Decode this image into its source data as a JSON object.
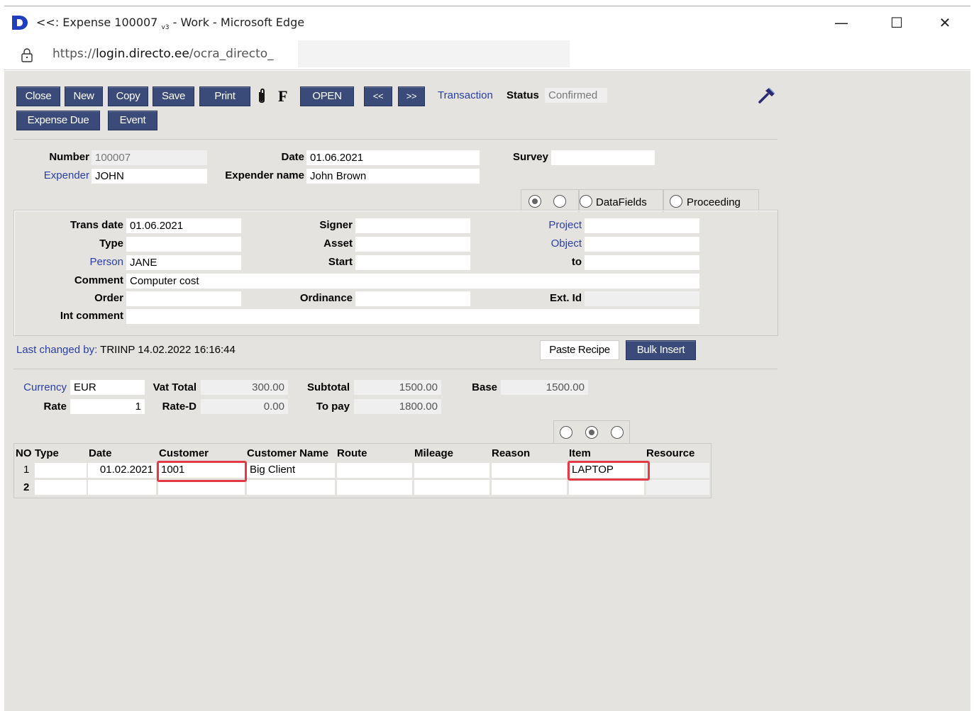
{
  "window": {
    "title_prefix": "<<: Expense 100007 ",
    "title_version": "v3",
    "title_suffix": " - Work - Microsoft Edge",
    "minimize": "—",
    "maximize": "☐",
    "close": "✕"
  },
  "address": {
    "scheme": "https://",
    "host": "login.directo.ee",
    "path": "/ocra_directo_"
  },
  "toolbar": {
    "close": "Close",
    "new": "New",
    "copy": "Copy",
    "save": "Save",
    "print": "Print",
    "attach": "🖇",
    "f": "F",
    "open": "OPEN",
    "prev": "<<",
    "next": ">>",
    "transaction": "Transaction",
    "status_label": "Status",
    "status_value": "Confirmed",
    "expense_due": "Expense Due",
    "event": "Event"
  },
  "header": {
    "number_label": "Number",
    "number": "100007",
    "date_label": "Date",
    "date": "01.06.2021",
    "survey_label": "Survey",
    "survey": "",
    "expender_label": "Expender",
    "expender": "JOHN",
    "expender_name_label": "Expender name",
    "expender_name": "John Brown"
  },
  "tabs": {
    "datafields": "DataFields",
    "proceeding": "Proceeding"
  },
  "detail": {
    "trans_date_label": "Trans date",
    "trans_date": "01.06.2021",
    "type_label": "Type",
    "type": "",
    "person_label": "Person",
    "person": "JANE",
    "comment_label": "Comment",
    "comment": "Computer cost",
    "order_label": "Order",
    "order": "",
    "int_comment_label": "Int comment",
    "int_comment": "",
    "signer_label": "Signer",
    "signer": "",
    "asset_label": "Asset",
    "asset": "",
    "start_label": "Start",
    "start": "",
    "ordinance_label": "Ordinance",
    "ordinance": "",
    "project_label": "Project",
    "project": "",
    "object_label": "Object",
    "object": "",
    "to_label": "to",
    "to": "",
    "ext_id_label": "Ext. Id",
    "ext_id": ""
  },
  "meta": {
    "last_changed_label": "Last changed by:",
    "last_changed_value": "TRIINP 14.02.2022 16:16:44",
    "paste_recipe": "Paste Recipe",
    "bulk_insert": "Bulk Insert"
  },
  "totals": {
    "currency_label": "Currency",
    "currency": "EUR",
    "rate_label": "Rate",
    "rate": "1",
    "vat_total_label": "Vat Total",
    "vat_total": "300.00",
    "rate_d_label": "Rate-D",
    "rate_d": "0.00",
    "subtotal_label": "Subtotal",
    "subtotal": "1500.00",
    "to_pay_label": "To pay",
    "to_pay": "1800.00",
    "base_label": "Base",
    "base": "1500.00"
  },
  "grid": {
    "headers": [
      "NO",
      "Type",
      "Date",
      "Customer",
      "Customer Name",
      "Route",
      "Mileage",
      "Reason",
      "Item",
      "Resource"
    ],
    "rows": [
      {
        "no": "1",
        "type": "",
        "date": "01.02.2021",
        "customer": "1001",
        "customer_name": "Big Client",
        "route": "",
        "mileage": "",
        "reason": "",
        "item": "LAPTOP",
        "resource": ""
      },
      {
        "no": "2",
        "type": "",
        "date": "",
        "customer": "",
        "customer_name": "",
        "route": "",
        "mileage": "",
        "reason": "",
        "item": "",
        "resource": ""
      }
    ]
  }
}
